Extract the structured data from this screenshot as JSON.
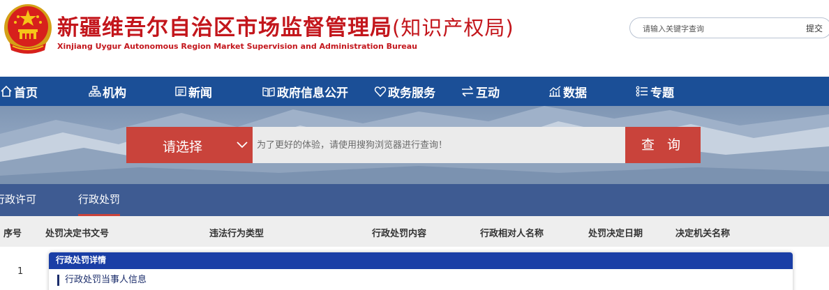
{
  "header": {
    "title_cn": "新疆维吾尔自治区市场监督管理局",
    "title_cn_sub": "(知识产权局)",
    "title_en": "Xinjiang Uygur Autonomous Region Market Supervision and Administration Bureau",
    "search_placeholder": "请输入关键字查询",
    "search_button": "提交"
  },
  "nav": {
    "items": [
      {
        "label": "首页",
        "icon": "home-icon"
      },
      {
        "label": "机构",
        "icon": "org-chart-icon"
      },
      {
        "label": "新闻",
        "icon": "news-icon"
      },
      {
        "label": "政府信息公开",
        "icon": "open-book-icon"
      },
      {
        "label": "政务服务",
        "icon": "heart-icon"
      },
      {
        "label": "互动",
        "icon": "exchange-arrows-icon"
      },
      {
        "label": "数据",
        "icon": "chart-icon"
      },
      {
        "label": "专题",
        "icon": "list-icon"
      }
    ]
  },
  "search_panel": {
    "select_label": "请选择",
    "input_placeholder": "为了更好的体验，请使用搜狗浏览器进行查询！",
    "button_label": "查 询"
  },
  "tabs": [
    {
      "label": "行政许可",
      "active": false
    },
    {
      "label": "行政处罚",
      "active": true
    }
  ],
  "table": {
    "columns": [
      "序号",
      "处罚决定书文号",
      "违法行为类型",
      "行政处罚内容",
      "行政相对人名称",
      "处罚决定日期",
      "决定机关名称"
    ],
    "rows": [
      {
        "index": "1"
      }
    ]
  },
  "modal": {
    "title": "行政处罚详情",
    "section_title": "行政处罚当事人信息"
  },
  "colors": {
    "brand_red": "#c3161c",
    "nav_blue": "#1b4f97",
    "tabs_blue": "#3e5b92",
    "search_red": "#c9433b",
    "modal_header": "#1a3ea6"
  }
}
